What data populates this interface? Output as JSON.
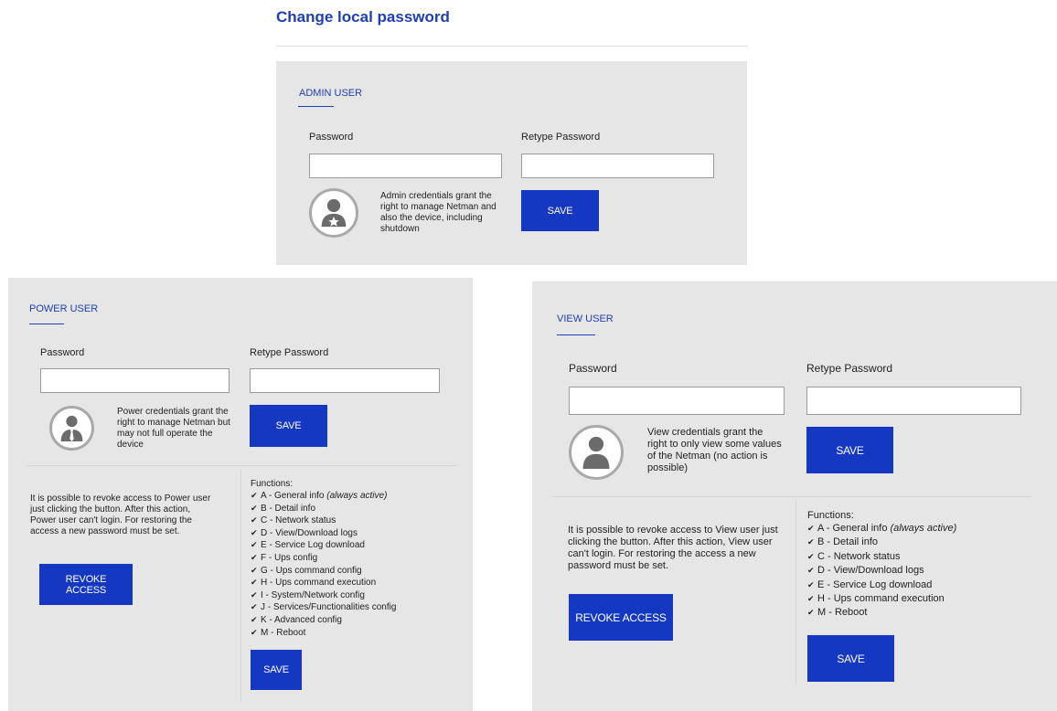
{
  "page": {
    "title": "Change local password"
  },
  "admin": {
    "title": "ADMIN USER",
    "password_label": "Password",
    "retype_label": "Retype Password",
    "password_value": "",
    "retype_value": "",
    "description": "Admin credentials grant the right to manage Netman and also the device, including shutdown",
    "save_label": "SAVE",
    "avatar_icon": "admin-user-star-icon"
  },
  "power": {
    "title": "POWER USER",
    "password_label": "Password",
    "retype_label": "Retype Password",
    "password_value": "",
    "retype_value": "",
    "description": "Power credentials grant the right to manage Netman but may not full operate the device",
    "save_label": "SAVE",
    "avatar_icon": "power-user-tie-icon",
    "revoke_text": "It is possible to revoke access to Power user just clicking the button. After this action, Power user can't login. For restoring the access a new password must be set.",
    "revoke_label": "REVOKE ACCESS",
    "functions_title": "Functions:",
    "functions": [
      {
        "text": "A - General info",
        "note": "(always active)"
      },
      {
        "text": "B - Detail info",
        "note": ""
      },
      {
        "text": "C - Network status",
        "note": ""
      },
      {
        "text": "D - View/Download logs",
        "note": ""
      },
      {
        "text": "E - Service Log download",
        "note": ""
      },
      {
        "text": "F - Ups config",
        "note": ""
      },
      {
        "text": "G - Ups command config",
        "note": ""
      },
      {
        "text": "H - Ups command execution",
        "note": ""
      },
      {
        "text": "I - System/Network config",
        "note": ""
      },
      {
        "text": "J - Services/Functionalities config",
        "note": ""
      },
      {
        "text": "K - Advanced config",
        "note": ""
      },
      {
        "text": "M - Reboot",
        "note": ""
      }
    ],
    "functions_save_label": "SAVE"
  },
  "view": {
    "title": "VIEW USER",
    "password_label": "Password",
    "retype_label": "Retype Password",
    "password_value": "",
    "retype_value": "",
    "description": "View credentials grant the right to only view some values of the Netman (no action is possible)",
    "save_label": "SAVE",
    "avatar_icon": "view-user-icon",
    "revoke_text": "It is possible to revoke access to View user just clicking the button. After this action, View user can't login. For restoring the access a new password must be set.",
    "revoke_label": "REVOKE ACCESS",
    "functions_title": "Functions:",
    "functions": [
      {
        "text": "A - General info",
        "note": "(always active)"
      },
      {
        "text": "B - Detail info",
        "note": ""
      },
      {
        "text": "C - Network status",
        "note": ""
      },
      {
        "text": "D - View/Download logs",
        "note": ""
      },
      {
        "text": "E - Service Log download",
        "note": ""
      },
      {
        "text": "H - Ups command execution",
        "note": ""
      },
      {
        "text": "M - Reboot",
        "note": ""
      }
    ],
    "functions_save_label": "SAVE"
  },
  "colors": {
    "accent": "#1f3fb3",
    "button": "#1538c2",
    "panel_bg": "#e6e6e6"
  }
}
